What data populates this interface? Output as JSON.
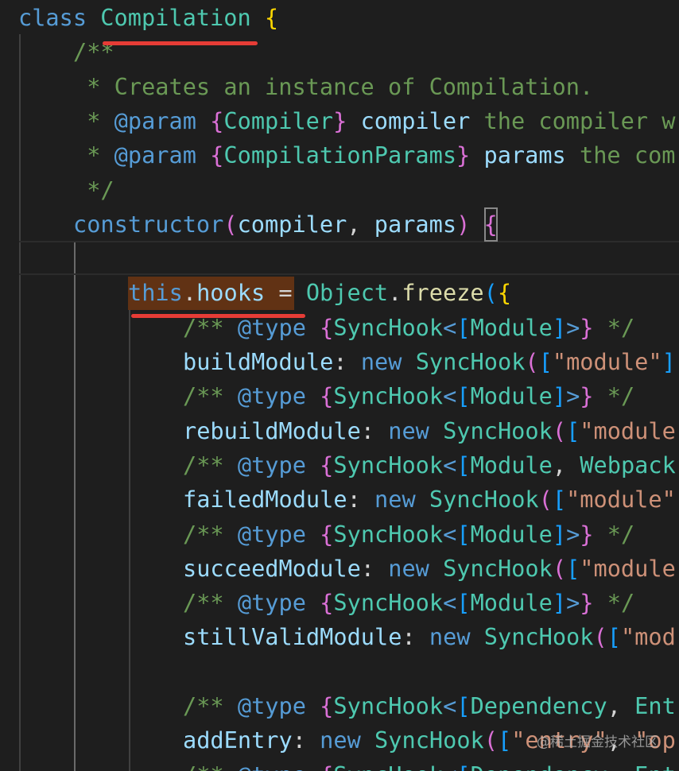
{
  "colors": {
    "background": "#1e1e1e",
    "keyword": "#569cd6",
    "class_name": "#4ec9b0",
    "comment": "#6a9955",
    "jsdoc_tag": "#569cd6",
    "variable": "#9cdcfe",
    "function": "#dcdcaa",
    "string": "#ce9178",
    "bracket_gold": "#ffd700",
    "bracket_pink": "#da70d6",
    "bracket_blue": "#179fff",
    "punctuation": "#d4d4d4",
    "selection_highlight": "#613214",
    "annotation_underline": "#e63c36"
  },
  "code": {
    "lines": [
      {
        "indent": 0,
        "tokens": [
          {
            "text": "class",
            "color": "#569cd6"
          },
          {
            "text": " ",
            "color": "#d4d4d4"
          },
          {
            "text": "Compilation",
            "color": "#4ec9b0"
          },
          {
            "text": " ",
            "color": "#d4d4d4"
          },
          {
            "text": "{",
            "color": "#ffd700"
          }
        ]
      },
      {
        "indent": 1,
        "tokens": [
          {
            "text": "/**",
            "color": "#6a9955"
          }
        ]
      },
      {
        "indent": 1,
        "tokens": [
          {
            "text": " * Creates an instance of Compilation.",
            "color": "#6a9955"
          }
        ]
      },
      {
        "indent": 1,
        "tokens": [
          {
            "text": " * ",
            "color": "#6a9955"
          },
          {
            "text": "@param",
            "color": "#569cd6"
          },
          {
            "text": " ",
            "color": "#6a9955"
          },
          {
            "text": "{",
            "color": "#da70d6"
          },
          {
            "text": "Compiler",
            "color": "#4ec9b0"
          },
          {
            "text": "}",
            "color": "#da70d6"
          },
          {
            "text": " ",
            "color": "#6a9955"
          },
          {
            "text": "compiler",
            "color": "#9cdcfe"
          },
          {
            "text": " the compiler w",
            "color": "#6a9955"
          }
        ]
      },
      {
        "indent": 1,
        "tokens": [
          {
            "text": " * ",
            "color": "#6a9955"
          },
          {
            "text": "@param",
            "color": "#569cd6"
          },
          {
            "text": " ",
            "color": "#6a9955"
          },
          {
            "text": "{",
            "color": "#da70d6"
          },
          {
            "text": "CompilationParams",
            "color": "#4ec9b0"
          },
          {
            "text": "}",
            "color": "#da70d6"
          },
          {
            "text": " ",
            "color": "#6a9955"
          },
          {
            "text": "params",
            "color": "#9cdcfe"
          },
          {
            "text": " the com",
            "color": "#6a9955"
          }
        ]
      },
      {
        "indent": 1,
        "tokens": [
          {
            "text": " */",
            "color": "#6a9955"
          }
        ]
      },
      {
        "indent": 1,
        "tokens": [
          {
            "text": "constructor",
            "color": "#569cd6"
          },
          {
            "text": "(",
            "color": "#da70d6"
          },
          {
            "text": "compiler",
            "color": "#9cdcfe"
          },
          {
            "text": ", ",
            "color": "#d4d4d4"
          },
          {
            "text": "params",
            "color": "#9cdcfe"
          },
          {
            "text": ")",
            "color": "#da70d6"
          },
          {
            "text": " ",
            "color": "#d4d4d4"
          },
          {
            "text": "{",
            "color": "#da70d6",
            "bracket_match": true
          }
        ]
      },
      {
        "indent": 2,
        "tokens": []
      },
      {
        "indent": 2,
        "tokens": [
          {
            "text": "this",
            "color": "#569cd6"
          },
          {
            "text": ".",
            "color": "#d4d4d4"
          },
          {
            "text": "hooks",
            "color": "#9cdcfe"
          },
          {
            "text": " = ",
            "color": "#d4d4d4"
          },
          {
            "text": "Object",
            "color": "#4ec9b0"
          },
          {
            "text": ".",
            "color": "#d4d4d4"
          },
          {
            "text": "freeze",
            "color": "#dcdcaa"
          },
          {
            "text": "(",
            "color": "#179fff"
          },
          {
            "text": "{",
            "color": "#ffd700"
          }
        ]
      },
      {
        "indent": 3,
        "tokens": [
          {
            "text": "/** ",
            "color": "#6a9955"
          },
          {
            "text": "@type",
            "color": "#569cd6"
          },
          {
            "text": " ",
            "color": "#6a9955"
          },
          {
            "text": "{",
            "color": "#da70d6"
          },
          {
            "text": "SyncHook",
            "color": "#4ec9b0"
          },
          {
            "text": "<",
            "color": "#569cd6"
          },
          {
            "text": "[",
            "color": "#179fff"
          },
          {
            "text": "Module",
            "color": "#4ec9b0"
          },
          {
            "text": "]",
            "color": "#179fff"
          },
          {
            "text": ">",
            "color": "#569cd6"
          },
          {
            "text": "}",
            "color": "#da70d6"
          },
          {
            "text": " */",
            "color": "#6a9955"
          }
        ]
      },
      {
        "indent": 3,
        "tokens": [
          {
            "text": "buildModule",
            "color": "#9cdcfe"
          },
          {
            "text": ": ",
            "color": "#d4d4d4"
          },
          {
            "text": "new",
            "color": "#569cd6"
          },
          {
            "text": " ",
            "color": "#d4d4d4"
          },
          {
            "text": "SyncHook",
            "color": "#4ec9b0"
          },
          {
            "text": "(",
            "color": "#da70d6"
          },
          {
            "text": "[",
            "color": "#179fff"
          },
          {
            "text": "\"module\"",
            "color": "#ce9178"
          },
          {
            "text": "]",
            "color": "#179fff"
          }
        ]
      },
      {
        "indent": 3,
        "tokens": [
          {
            "text": "/** ",
            "color": "#6a9955"
          },
          {
            "text": "@type",
            "color": "#569cd6"
          },
          {
            "text": " ",
            "color": "#6a9955"
          },
          {
            "text": "{",
            "color": "#da70d6"
          },
          {
            "text": "SyncHook",
            "color": "#4ec9b0"
          },
          {
            "text": "<",
            "color": "#569cd6"
          },
          {
            "text": "[",
            "color": "#179fff"
          },
          {
            "text": "Module",
            "color": "#4ec9b0"
          },
          {
            "text": "]",
            "color": "#179fff"
          },
          {
            "text": ">",
            "color": "#569cd6"
          },
          {
            "text": "}",
            "color": "#da70d6"
          },
          {
            "text": " */",
            "color": "#6a9955"
          }
        ]
      },
      {
        "indent": 3,
        "tokens": [
          {
            "text": "rebuildModule",
            "color": "#9cdcfe"
          },
          {
            "text": ": ",
            "color": "#d4d4d4"
          },
          {
            "text": "new",
            "color": "#569cd6"
          },
          {
            "text": " ",
            "color": "#d4d4d4"
          },
          {
            "text": "SyncHook",
            "color": "#4ec9b0"
          },
          {
            "text": "(",
            "color": "#da70d6"
          },
          {
            "text": "[",
            "color": "#179fff"
          },
          {
            "text": "\"module",
            "color": "#ce9178"
          }
        ]
      },
      {
        "indent": 3,
        "tokens": [
          {
            "text": "/** ",
            "color": "#6a9955"
          },
          {
            "text": "@type",
            "color": "#569cd6"
          },
          {
            "text": " ",
            "color": "#6a9955"
          },
          {
            "text": "{",
            "color": "#da70d6"
          },
          {
            "text": "SyncHook",
            "color": "#4ec9b0"
          },
          {
            "text": "<",
            "color": "#569cd6"
          },
          {
            "text": "[",
            "color": "#179fff"
          },
          {
            "text": "Module",
            "color": "#4ec9b0"
          },
          {
            "text": ", ",
            "color": "#d4d4d4"
          },
          {
            "text": "Webpack",
            "color": "#4ec9b0"
          }
        ]
      },
      {
        "indent": 3,
        "tokens": [
          {
            "text": "failedModule",
            "color": "#9cdcfe"
          },
          {
            "text": ": ",
            "color": "#d4d4d4"
          },
          {
            "text": "new",
            "color": "#569cd6"
          },
          {
            "text": " ",
            "color": "#d4d4d4"
          },
          {
            "text": "SyncHook",
            "color": "#4ec9b0"
          },
          {
            "text": "(",
            "color": "#da70d6"
          },
          {
            "text": "[",
            "color": "#179fff"
          },
          {
            "text": "\"module\"",
            "color": "#ce9178"
          }
        ]
      },
      {
        "indent": 3,
        "tokens": [
          {
            "text": "/** ",
            "color": "#6a9955"
          },
          {
            "text": "@type",
            "color": "#569cd6"
          },
          {
            "text": " ",
            "color": "#6a9955"
          },
          {
            "text": "{",
            "color": "#da70d6"
          },
          {
            "text": "SyncHook",
            "color": "#4ec9b0"
          },
          {
            "text": "<",
            "color": "#569cd6"
          },
          {
            "text": "[",
            "color": "#179fff"
          },
          {
            "text": "Module",
            "color": "#4ec9b0"
          },
          {
            "text": "]",
            "color": "#179fff"
          },
          {
            "text": ">",
            "color": "#569cd6"
          },
          {
            "text": "}",
            "color": "#da70d6"
          },
          {
            "text": " */",
            "color": "#6a9955"
          }
        ]
      },
      {
        "indent": 3,
        "tokens": [
          {
            "text": "succeedModule",
            "color": "#9cdcfe"
          },
          {
            "text": ": ",
            "color": "#d4d4d4"
          },
          {
            "text": "new",
            "color": "#569cd6"
          },
          {
            "text": " ",
            "color": "#d4d4d4"
          },
          {
            "text": "SyncHook",
            "color": "#4ec9b0"
          },
          {
            "text": "(",
            "color": "#da70d6"
          },
          {
            "text": "[",
            "color": "#179fff"
          },
          {
            "text": "\"module",
            "color": "#ce9178"
          }
        ]
      },
      {
        "indent": 3,
        "tokens": [
          {
            "text": "/** ",
            "color": "#6a9955"
          },
          {
            "text": "@type",
            "color": "#569cd6"
          },
          {
            "text": " ",
            "color": "#6a9955"
          },
          {
            "text": "{",
            "color": "#da70d6"
          },
          {
            "text": "SyncHook",
            "color": "#4ec9b0"
          },
          {
            "text": "<",
            "color": "#569cd6"
          },
          {
            "text": "[",
            "color": "#179fff"
          },
          {
            "text": "Module",
            "color": "#4ec9b0"
          },
          {
            "text": "]",
            "color": "#179fff"
          },
          {
            "text": ">",
            "color": "#569cd6"
          },
          {
            "text": "}",
            "color": "#da70d6"
          },
          {
            "text": " */",
            "color": "#6a9955"
          }
        ]
      },
      {
        "indent": 3,
        "tokens": [
          {
            "text": "stillValidModule",
            "color": "#9cdcfe"
          },
          {
            "text": ": ",
            "color": "#d4d4d4"
          },
          {
            "text": "new",
            "color": "#569cd6"
          },
          {
            "text": " ",
            "color": "#d4d4d4"
          },
          {
            "text": "SyncHook",
            "color": "#4ec9b0"
          },
          {
            "text": "(",
            "color": "#da70d6"
          },
          {
            "text": "[",
            "color": "#179fff"
          },
          {
            "text": "\"mod",
            "color": "#ce9178"
          }
        ]
      },
      {
        "indent": 3,
        "tokens": []
      },
      {
        "indent": 3,
        "tokens": [
          {
            "text": "/** ",
            "color": "#6a9955"
          },
          {
            "text": "@type",
            "color": "#569cd6"
          },
          {
            "text": " ",
            "color": "#6a9955"
          },
          {
            "text": "{",
            "color": "#da70d6"
          },
          {
            "text": "SyncHook",
            "color": "#4ec9b0"
          },
          {
            "text": "<",
            "color": "#569cd6"
          },
          {
            "text": "[",
            "color": "#179fff"
          },
          {
            "text": "Dependency",
            "color": "#4ec9b0"
          },
          {
            "text": ", ",
            "color": "#d4d4d4"
          },
          {
            "text": "Ent",
            "color": "#4ec9b0"
          }
        ]
      },
      {
        "indent": 3,
        "tokens": [
          {
            "text": "addEntry",
            "color": "#9cdcfe"
          },
          {
            "text": ": ",
            "color": "#d4d4d4"
          },
          {
            "text": "new",
            "color": "#569cd6"
          },
          {
            "text": " ",
            "color": "#d4d4d4"
          },
          {
            "text": "SyncHook",
            "color": "#4ec9b0"
          },
          {
            "text": "(",
            "color": "#da70d6"
          },
          {
            "text": "[",
            "color": "#179fff"
          },
          {
            "text": "\"entry\"",
            "color": "#ce9178"
          },
          {
            "text": ", ",
            "color": "#d4d4d4"
          },
          {
            "text": "\"op",
            "color": "#ce9178"
          }
        ]
      },
      {
        "indent": 3,
        "tokens": [
          {
            "text": "/** ",
            "color": "#6a9955"
          },
          {
            "text": "@type",
            "color": "#569cd6"
          },
          {
            "text": " ",
            "color": "#6a9955"
          },
          {
            "text": "{",
            "color": "#da70d6"
          },
          {
            "text": "SyncHook",
            "color": "#4ec9b0"
          },
          {
            "text": "<",
            "color": "#569cd6"
          },
          {
            "text": "[",
            "color": "#179fff"
          },
          {
            "text": "Dependency",
            "color": "#4ec9b0"
          },
          {
            "text": ", ",
            "color": "#d4d4d4"
          },
          {
            "text": "Ent",
            "color": "#4ec9b0"
          }
        ]
      }
    ]
  },
  "watermark": {
    "text": "@稀土掘金技术社区"
  }
}
